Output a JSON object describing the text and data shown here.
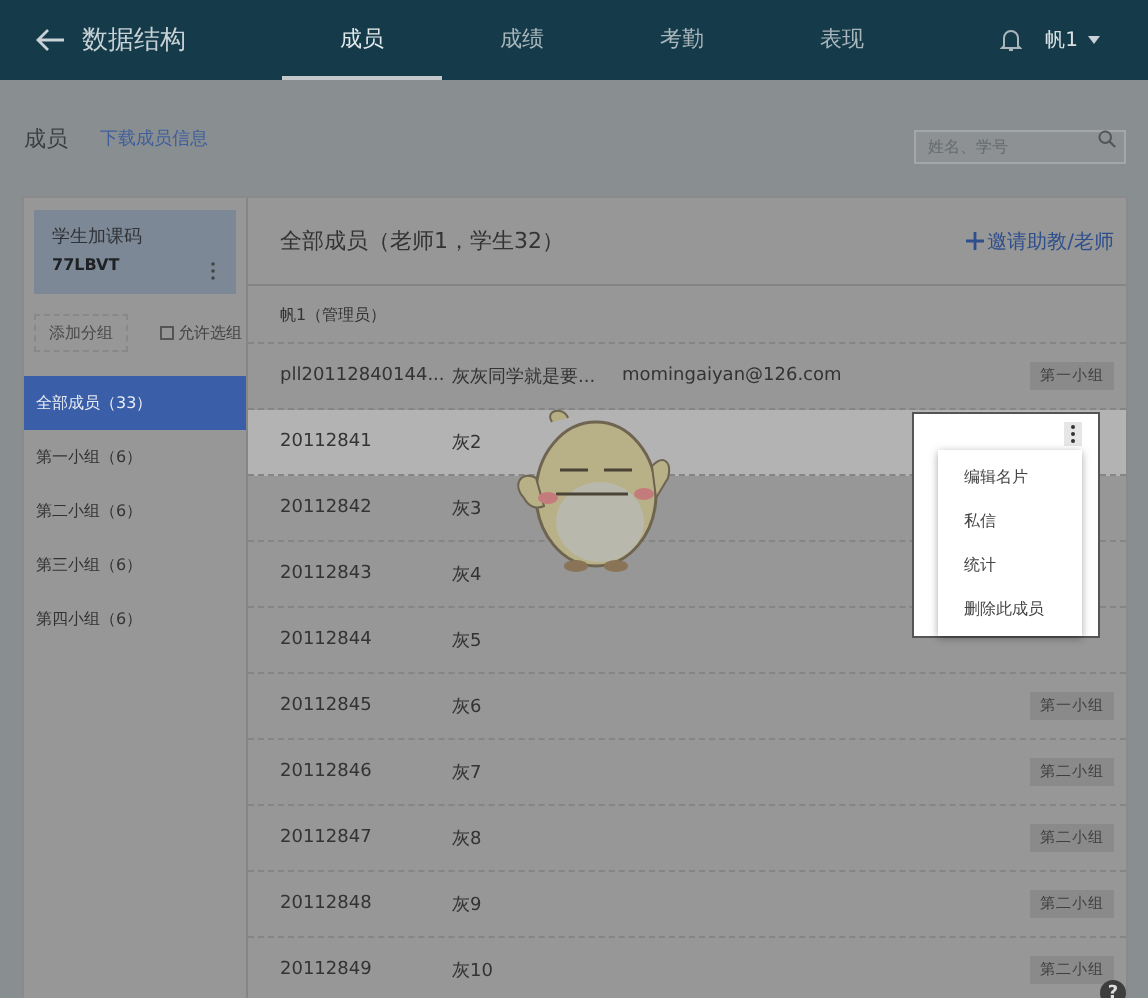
{
  "header": {
    "title": "数据结构",
    "tabs": [
      {
        "label": "成员",
        "selected": true
      },
      {
        "label": "成绩",
        "selected": false
      },
      {
        "label": "考勤",
        "selected": false
      },
      {
        "label": "表现",
        "selected": false
      }
    ],
    "user": "帆1"
  },
  "page": {
    "title": "成员",
    "download_link": "下载成员信息",
    "search": {
      "placeholder": "姓名、学号"
    }
  },
  "sidebar": {
    "code_label": "学生加课码",
    "code": "77LBVT",
    "add_group_button": "添加分组",
    "allow_choose": {
      "label": "允许选组",
      "checked": false
    },
    "groups": [
      {
        "label": "全部成员（33）",
        "selected": true
      },
      {
        "label": "第一小组（6）",
        "selected": false
      },
      {
        "label": "第二小组（6）",
        "selected": false
      },
      {
        "label": "第三小组（6）",
        "selected": false
      },
      {
        "label": "第四小组（6）",
        "selected": false
      }
    ]
  },
  "members": {
    "title": "全部成员（老师1，学生32）",
    "invite": "邀请助教/老师",
    "admin": "帆1（管理员）",
    "rows": [
      {
        "id": "pll20112840144...",
        "name": "灰灰同学就是要...",
        "email": "momingaiyan@126.com",
        "group": "第一小组",
        "selected": false
      },
      {
        "id": "20112841",
        "name": "灰2",
        "selected": true
      },
      {
        "id": "20112842",
        "name": "灰3",
        "selected": false
      },
      {
        "id": "20112843",
        "name": "灰4",
        "selected": false
      },
      {
        "id": "20112844",
        "name": "灰5",
        "selected": false
      },
      {
        "id": "20112845",
        "name": "灰6",
        "group": "第一小组",
        "selected": false
      },
      {
        "id": "20112846",
        "name": "灰7",
        "group": "第二小组",
        "selected": false
      },
      {
        "id": "20112847",
        "name": "灰8",
        "group": "第二小组",
        "selected": false
      },
      {
        "id": "20112848",
        "name": "灰9",
        "group": "第二小组",
        "selected": false
      },
      {
        "id": "20112849",
        "name": "灰10",
        "group": "第二小组",
        "selected": false
      }
    ],
    "context_menu": [
      "编辑名片",
      "私信",
      "统计",
      "删除此成员"
    ]
  },
  "help_button": "?"
}
